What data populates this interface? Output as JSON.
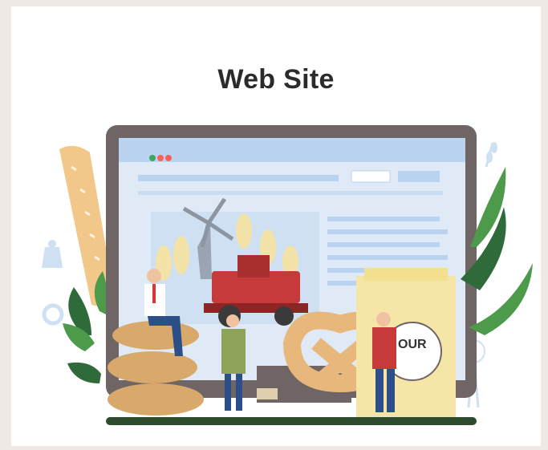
{
  "title": "Web Site",
  "flour_bag_label": "OUR",
  "colors": {
    "background": "#efe9e6",
    "card": "#ffffff",
    "monitor_frame": "#6f6565",
    "screen": "#dfeaf6",
    "header_blue": "#b9d3f0",
    "bread": "#f2c88a",
    "leaf_dark": "#2f6b3a",
    "leaf_light": "#4e9a4b",
    "harvester": "#c63a3a",
    "ground": "#2e4a2f"
  },
  "icons": {
    "window_dots": [
      "green-dot-icon",
      "red-dot-icon",
      "red-dot-icon"
    ]
  }
}
